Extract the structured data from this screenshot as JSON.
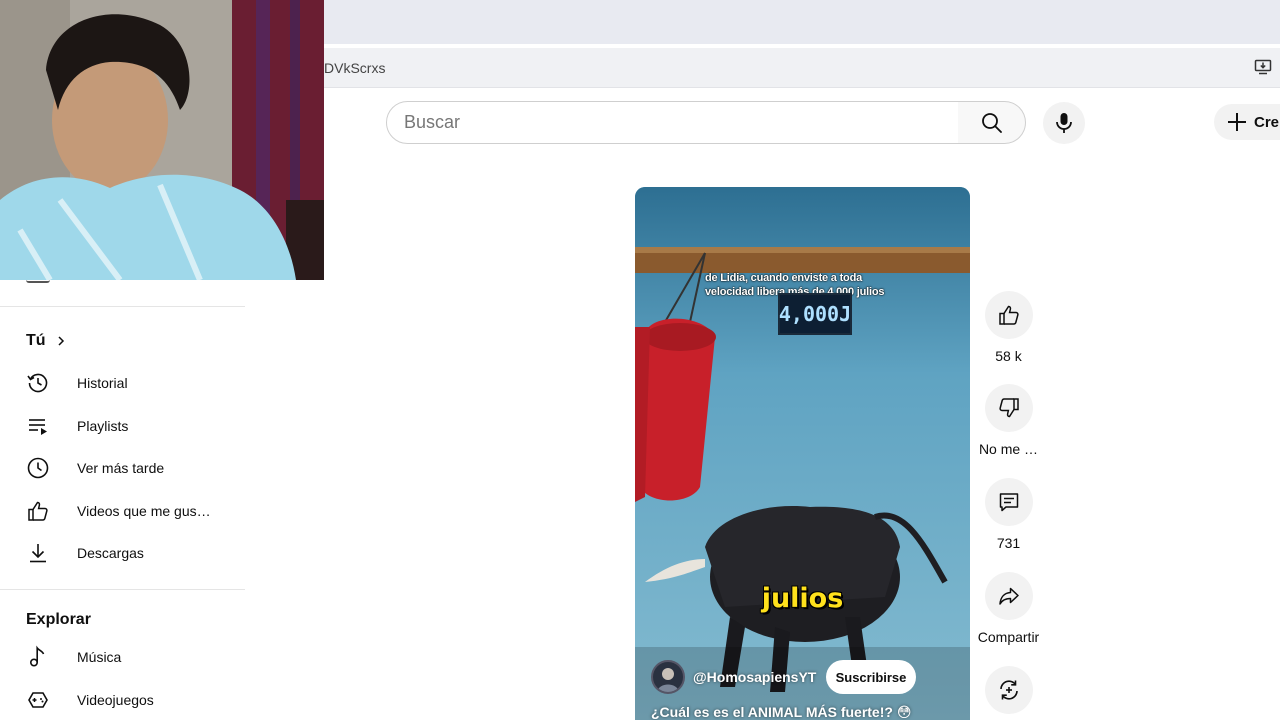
{
  "browser": {
    "address_text": "DVkScrxs"
  },
  "header": {
    "search_placeholder": "Buscar",
    "create_label": "Cre"
  },
  "sidebar": {
    "you_heading": "Tú",
    "you_items": [
      {
        "label": "Historial",
        "icon": "history-icon"
      },
      {
        "label": "Playlists",
        "icon": "playlists-icon"
      },
      {
        "label": "Ver más tarde",
        "icon": "watch-later-icon"
      },
      {
        "label": "Videos que me gus…",
        "icon": "liked-videos-icon"
      },
      {
        "label": "Descargas",
        "icon": "download-icon"
      }
    ],
    "explore_heading": "Explorar",
    "explore_items": [
      {
        "label": "Música",
        "icon": "music-icon"
      },
      {
        "label": "Videojuegos",
        "icon": "gaming-icon"
      }
    ]
  },
  "short": {
    "subtitle_line1": "de Lidia, cuando enviste a toda",
    "subtitle_line2": "velocidad libera más de 4,000 julios",
    "meter_value": "4,000J",
    "caption_word": "julios",
    "channel_name": "@HomosapiensYT",
    "subscribe_label": "Suscribirse",
    "title": "¿Cuál es es el ANIMAL MÁS fuerte!? 😳"
  },
  "actions": {
    "like_count": "58 k",
    "dislike_label": "No me …",
    "comments_count": "731",
    "share_label": "Compartir"
  },
  "colors": {
    "accent": "#ffe11c",
    "video_bg": "#5fa0bb",
    "bag_red": "#c8202a"
  }
}
